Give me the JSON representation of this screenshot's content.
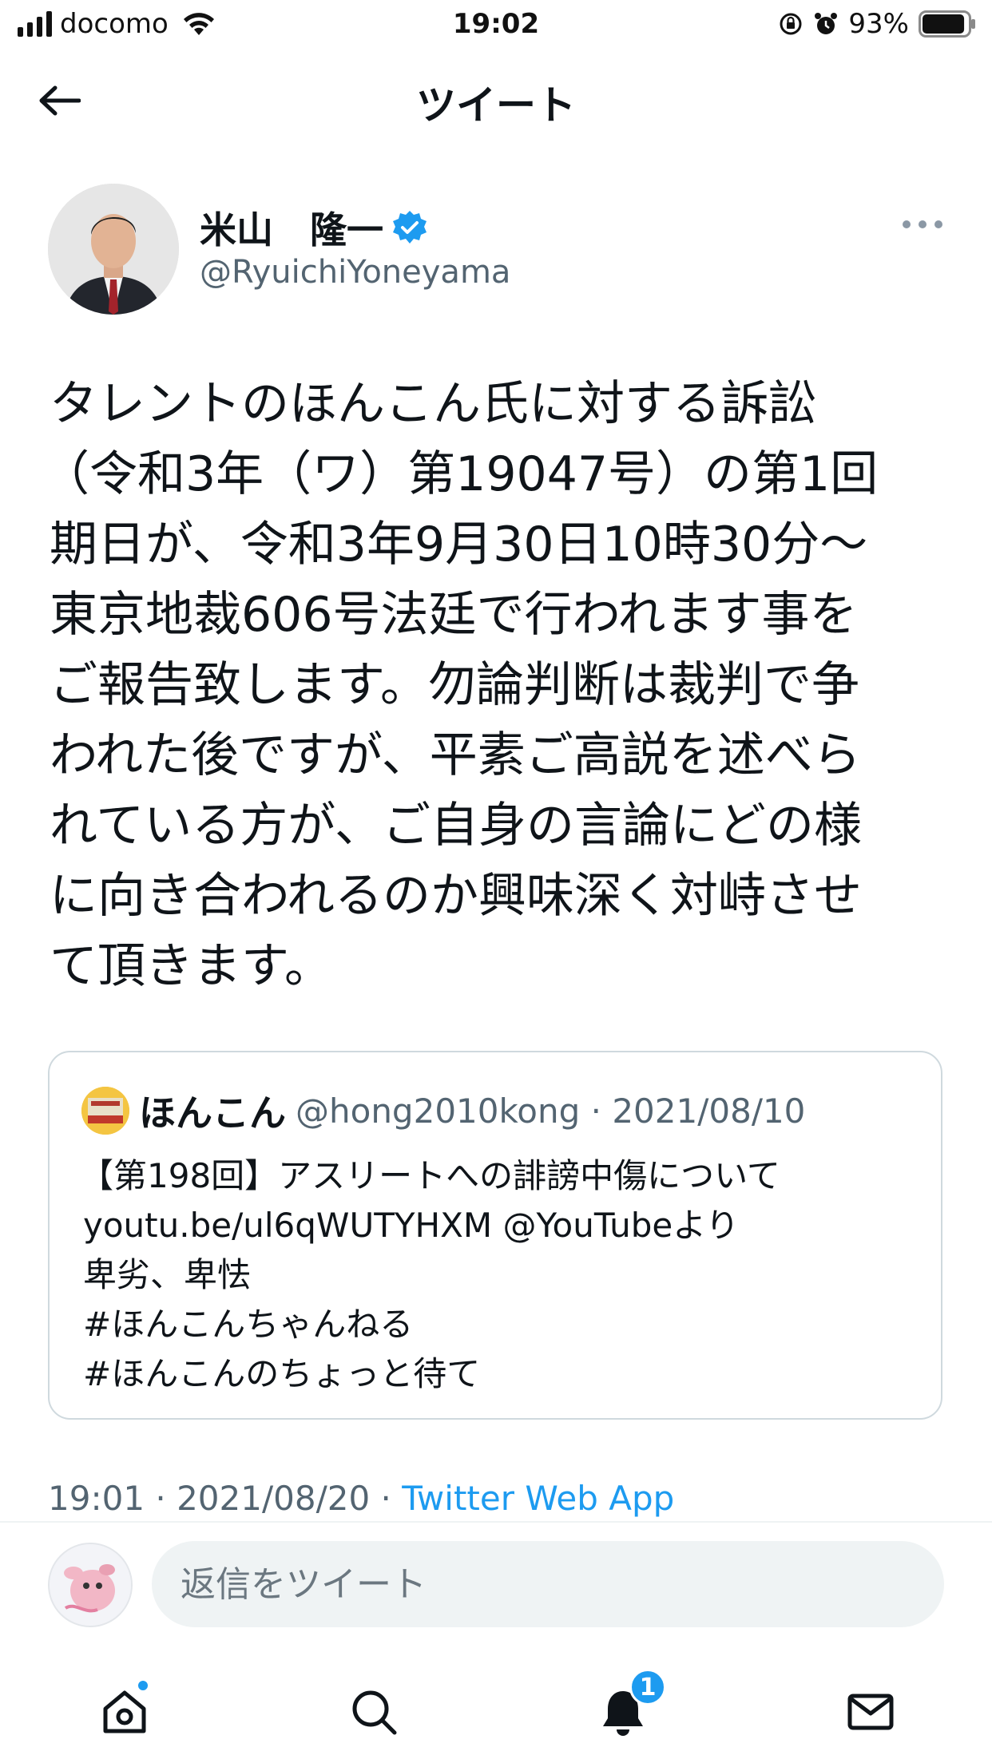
{
  "status_bar": {
    "carrier": "docomo",
    "time": "19:02",
    "battery": "93%",
    "battery_level": 0.93
  },
  "header": {
    "title": "ツイート"
  },
  "tweet": {
    "author_name": "米山　隆一",
    "author_handle": "@RyuichiYoneyama",
    "verified": true,
    "lines": [
      "タレントのほんこん氏に対する訴訟",
      "（令和3年（ワ）第19047号）の第1回",
      "期日が、令和3年9月30日10時30分～",
      "東京地裁606号法廷で行われます事を",
      "ご報告致します。勿論判断は裁判で争",
      "われた後ですが、平素ご高説を述べら",
      "れている方が、ご自身の言論にどの様",
      "に向き合われるのか興味深く対峙させ",
      "て頂きます。"
    ],
    "timestamp": "19:01 · 2021/08/20 · ",
    "source": "Twitter Web App"
  },
  "quoted": {
    "name": "ほんこん",
    "handle_date": "@hong2010kong · 2021/08/10",
    "lines": [
      "【第198回】アスリートへの誹謗中傷について",
      "youtu.be/ul6qWUTYHXM @YouTubeより",
      "卑劣、卑怯",
      "#ほんこんちゃんねる",
      "#ほんこんのちょっと待て"
    ]
  },
  "reply": {
    "placeholder": "返信をツイート"
  },
  "tabbar": {
    "notifications_badge": "1",
    "icons": [
      "home-icon",
      "search-icon",
      "bell-icon",
      "mail-icon"
    ]
  },
  "colors": {
    "accent": "#1d9bf0",
    "secondary_text": "#536471",
    "border": "#cfd9de"
  }
}
